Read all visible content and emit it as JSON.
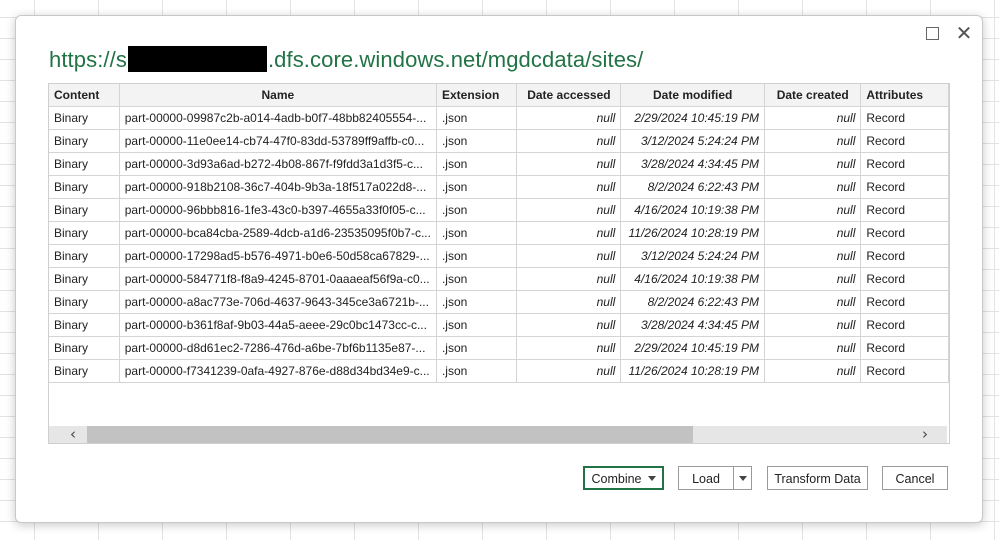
{
  "dialog": {
    "url_prefix": "https://s",
    "url_suffix": ".dfs.core.windows.net/mgdcdata/sites/",
    "maximize_icon": "maximize-icon",
    "close_icon": "close-icon"
  },
  "table": {
    "columns": [
      "Content",
      "Name",
      "Extension",
      "Date accessed",
      "Date modified",
      "Date created",
      "Attributes"
    ],
    "rows": [
      [
        "Binary",
        "part-00000-09987c2b-a014-4adb-b0f7-48bb82405554-...",
        ".json",
        "null",
        "2/29/2024 10:45:19 PM",
        "null",
        "Record"
      ],
      [
        "Binary",
        "part-00000-11e0ee14-cb74-47f0-83dd-53789ff9affb-c0...",
        ".json",
        "null",
        "3/12/2024 5:24:24 PM",
        "null",
        "Record"
      ],
      [
        "Binary",
        "part-00000-3d93a6ad-b272-4b08-867f-f9fdd3a1d3f5-c...",
        ".json",
        "null",
        "3/28/2024 4:34:45 PM",
        "null",
        "Record"
      ],
      [
        "Binary",
        "part-00000-918b2108-36c7-404b-9b3a-18f517a022d8-...",
        ".json",
        "null",
        "8/2/2024 6:22:43 PM",
        "null",
        "Record"
      ],
      [
        "Binary",
        "part-00000-96bbb816-1fe3-43c0-b397-4655a33f0f05-c...",
        ".json",
        "null",
        "4/16/2024 10:19:38 PM",
        "null",
        "Record"
      ],
      [
        "Binary",
        "part-00000-bca84cba-2589-4dcb-a1d6-23535095f0b7-c...",
        ".json",
        "null",
        "11/26/2024 10:28:19 PM",
        "null",
        "Record"
      ],
      [
        "Binary",
        "part-00000-17298ad5-b576-4971-b0e6-50d58ca67829-...",
        ".json",
        "null",
        "3/12/2024 5:24:24 PM",
        "null",
        "Record"
      ],
      [
        "Binary",
        "part-00000-584771f8-f8a9-4245-8701-0aaaeaf56f9a-c0...",
        ".json",
        "null",
        "4/16/2024 10:19:38 PM",
        "null",
        "Record"
      ],
      [
        "Binary",
        "part-00000-a8ac773e-706d-4637-9643-345ce3a6721b-...",
        ".json",
        "null",
        "8/2/2024 6:22:43 PM",
        "null",
        "Record"
      ],
      [
        "Binary",
        "part-00000-b361f8af-9b03-44a5-aeee-29c0bc1473cc-c...",
        ".json",
        "null",
        "3/28/2024 4:34:45 PM",
        "null",
        "Record"
      ],
      [
        "Binary",
        "part-00000-d8d61ec2-7286-476d-a6be-7bf6b1135e87-...",
        ".json",
        "null",
        "2/29/2024 10:45:19 PM",
        "null",
        "Record"
      ],
      [
        "Binary",
        "part-00000-f7341239-0afa-4927-876e-d88d34bd34e9-c...",
        ".json",
        "null",
        "11/26/2024 10:28:19 PM",
        "null",
        "Record"
      ]
    ]
  },
  "scrollbar": {
    "left_arrow": "‹",
    "right_arrow": "›"
  },
  "buttons": {
    "combine": "Combine",
    "load": "Load",
    "transform": "Transform Data",
    "cancel": "Cancel"
  },
  "colors": {
    "accent": "#217346"
  }
}
